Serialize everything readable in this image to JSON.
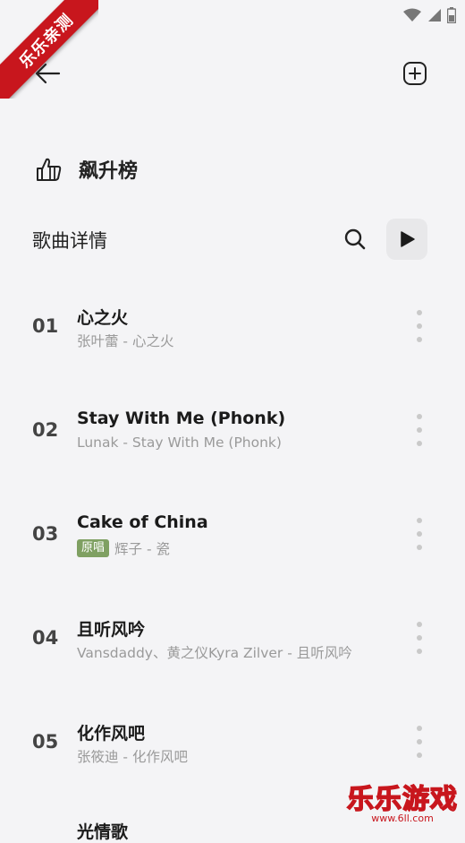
{
  "watermark": {
    "ribbon_text": "乐乐亲测",
    "corner_text": "乐乐游戏",
    "corner_url": "www.6ll.com"
  },
  "header": {
    "chart_name": "飙升榜"
  },
  "section": {
    "title": "歌曲详情"
  },
  "songs": [
    {
      "rank": "01",
      "title": "心之火",
      "badge": "",
      "subtitle": "张叶蕾 - 心之火"
    },
    {
      "rank": "02",
      "title": "Stay With Me (Phonk)",
      "badge": "",
      "subtitle": "Lunak - Stay With Me (Phonk)"
    },
    {
      "rank": "03",
      "title": "Cake of China",
      "badge": "原唱",
      "subtitle": "辉子 - 瓷"
    },
    {
      "rank": "04",
      "title": "且听风吟",
      "badge": "",
      "subtitle": "Vansdaddy、黄之仪Kyra Zilver - 且听风吟"
    },
    {
      "rank": "05",
      "title": "化作风吧",
      "badge": "",
      "subtitle": "张筱迪 - 化作风吧"
    }
  ],
  "partial_song_title": "光情歌",
  "colors": {
    "badge": "#7fa062",
    "accent_red": "#c8161d",
    "background": "#f4f4f6"
  },
  "icons": [
    "wifi-icon",
    "signal-icon",
    "battery-icon",
    "back-arrow-icon",
    "add-playlist-icon",
    "chart-hand-icon",
    "search-icon",
    "play-icon",
    "more-vertical-icon"
  ]
}
